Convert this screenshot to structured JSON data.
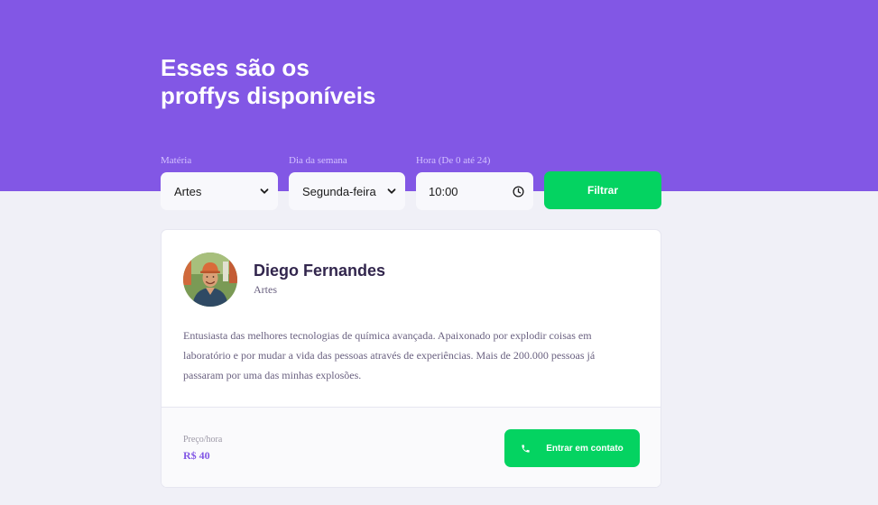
{
  "header": {
    "title_line1": "Esses são os",
    "title_line2": "proffys disponíveis"
  },
  "filters": {
    "subject": {
      "label": "Matéria",
      "value": "Artes",
      "icon": "chevron-down-icon"
    },
    "weekday": {
      "label": "Dia da semana",
      "value": "Segunda-feira",
      "icon": "chevron-down-icon"
    },
    "time": {
      "label": "Hora (De 0 até 24)",
      "value": "10:00",
      "icon": "clock-icon"
    },
    "submit_label": "Filtrar"
  },
  "teacher": {
    "name": "Diego Fernandes",
    "subject": "Artes",
    "bio": "Entusiasta das melhores tecnologias de química avançada. Apaixonado por explodir coisas em laboratório e por mudar a vida das pessoas através de experiências. Mais de 200.000 pessoas já passaram por uma das minhas explosões.",
    "price_label": "Preço/hora",
    "price": "R$ 40",
    "contact_label": "Entrar em contato",
    "contact_icon": "whatsapp-icon"
  },
  "colors": {
    "primary": "#8257e5",
    "secondary": "#04d361",
    "background": "#f0f0f7",
    "title_text": "#32264d",
    "body_text": "#6a6180"
  }
}
